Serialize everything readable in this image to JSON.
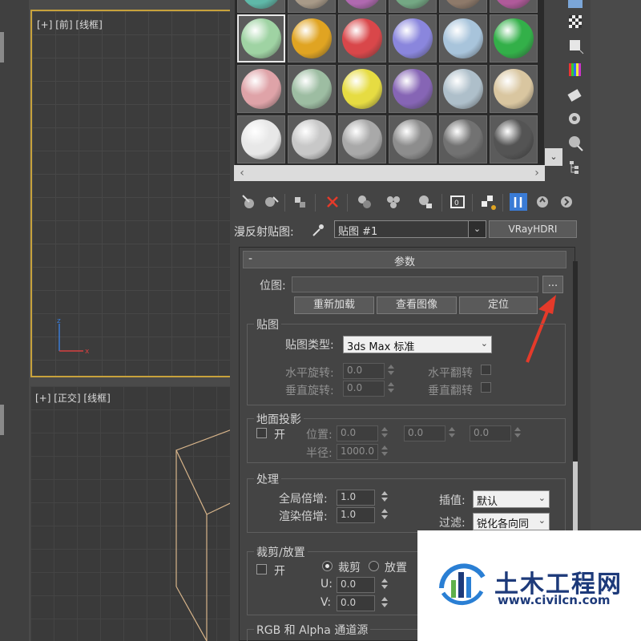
{
  "viewports": {
    "top_label": "[+] [前] [线框]",
    "bottom_label": "[+] [正交] [线框]",
    "axis_x": "x",
    "axis_z": "z"
  },
  "material_slots": {
    "colors": [
      [
        "#9fd3a3",
        "#e0a422",
        "#d9474a",
        "#8a86dd",
        "#a8c4db",
        "#33b049"
      ],
      [
        "#dfa3a8",
        "#9dbda2",
        "#e6dc42",
        "#8665b5",
        "#aebfca",
        "#d9c6a0"
      ],
      [
        "#e8e8e8",
        "#c8c8c8",
        "#a9a9a9",
        "#8d8d8d",
        "#727272",
        "#545454"
      ]
    ]
  },
  "map_row": {
    "label": "漫反射贴图:",
    "map_name": "贴图 #1",
    "map_type": "VRayHDRI"
  },
  "rollout": {
    "title": "参数",
    "bitmap_label": "位图:",
    "bitmap_value": "",
    "browse_label": "...",
    "reload": "重新加载",
    "view_image": "查看图像",
    "locate": "定位",
    "map_group": {
      "title": "贴图",
      "type_label": "贴图类型:",
      "type_value": "3ds Max 标准",
      "h_rotate_label": "水平旋转:",
      "h_rotate_value": "0.0",
      "v_rotate_label": "垂直旋转:",
      "v_rotate_value": "0.0",
      "h_flip_label": "水平翻转",
      "v_flip_label": "垂直翻转"
    },
    "ground_group": {
      "title": "地面投影",
      "on_label": "开",
      "pos_label": "位置:",
      "pos_values": [
        "0.0",
        "0.0",
        "0.0"
      ],
      "radius_label": "半径:",
      "radius_value": "1000.0"
    },
    "process_group": {
      "title": "处理",
      "global_mult_label": "全局倍增:",
      "global_mult_value": "1.0",
      "render_mult_label": "渲染倍增:",
      "render_mult_value": "1.0",
      "interp_label": "插值:",
      "interp_value": "默认",
      "filter_label": "过滤:",
      "filter_value": "锐化各向同"
    },
    "crop_group": {
      "title": "裁剪/放置",
      "on_label": "开",
      "crop_label": "裁剪",
      "place_label": "放置",
      "u_label": "U:",
      "u_value": "0.0",
      "v_label": "V:",
      "v_value": "0.0"
    },
    "rgb_group_title": "RGB 和 Alpha 通道源"
  },
  "watermark": {
    "name": "土木工程网",
    "url": "www.civilcn.com"
  },
  "colors": {
    "viewport_active_border": "#c8a23c",
    "accent_red": "#e53a2a",
    "watermark_blue": "#1d3a7a"
  }
}
